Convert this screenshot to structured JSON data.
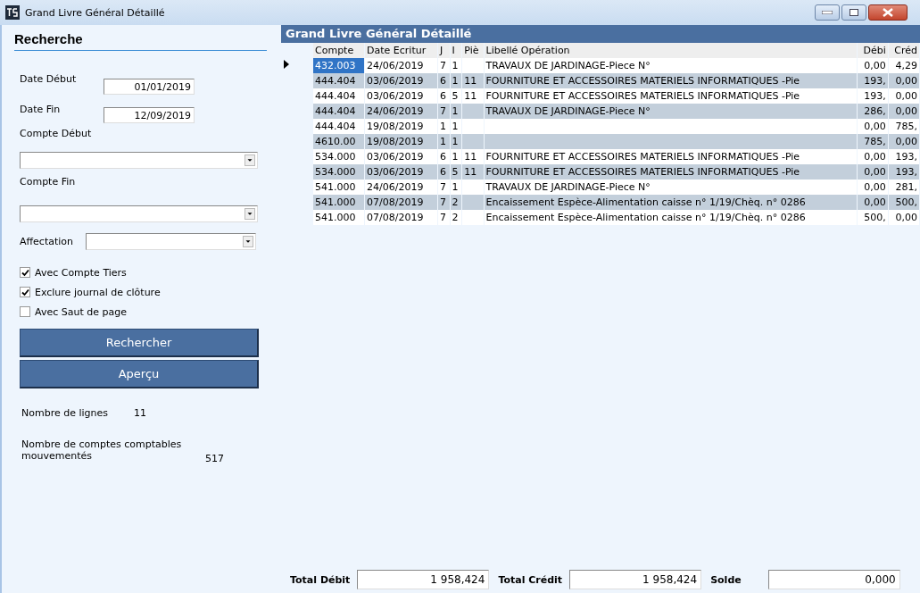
{
  "window": {
    "title": "Grand Livre Général Détaillé"
  },
  "search": {
    "title": "Recherche",
    "date_debut": {
      "label": "Date Début",
      "value": "01/01/2019"
    },
    "date_fin": {
      "label": "Date Fin",
      "value": "12/09/2019"
    },
    "compte_debut": {
      "label": "Compte Début"
    },
    "compte_fin": {
      "label": "Compte Fin"
    },
    "affectation": {
      "label": "Affectation"
    },
    "options": [
      {
        "label": "Avec Compte Tiers",
        "checked": true
      },
      {
        "label": "Exclure journal de clôture",
        "checked": true
      },
      {
        "label": "Avec Saut de page",
        "checked": false
      }
    ],
    "buttons": [
      "Rechercher",
      "Aperçu"
    ],
    "stats": [
      {
        "label": "Nombre de lignes",
        "value": "11"
      },
      {
        "label": "Nombre de comptes comptables mouvementés",
        "value": "517"
      }
    ]
  },
  "ledger": {
    "title": "Grand Livre Général Détaillé",
    "columns": [
      "Compte",
      "Date Ecritur",
      "J",
      "I",
      "Piè",
      "Libellé Opération",
      "Débi",
      "Créd"
    ],
    "rows": [
      {
        "selected": true,
        "cells": [
          "432.003",
          "24/06/2019",
          "7",
          "1",
          "",
          "TRAVAUX DE JARDINAGE-Piece N°",
          "0,00",
          "4,29"
        ]
      },
      {
        "selected": false,
        "cells": [
          "444.404",
          "03/06/2019",
          "6",
          "1",
          "11",
          "FOURNITURE ET ACCESSOIRES MATERIELS INFORMATIQUES -Pie",
          "193,",
          "0,00"
        ]
      },
      {
        "selected": false,
        "cells": [
          "444.404",
          "03/06/2019",
          "6",
          "5",
          "11",
          "FOURNITURE ET ACCESSOIRES MATERIELS INFORMATIQUES -Pie",
          "193,",
          "0,00"
        ]
      },
      {
        "selected": false,
        "cells": [
          "444.404",
          "24/06/2019",
          "7",
          "1",
          "",
          "TRAVAUX DE JARDINAGE-Piece N°",
          "286,",
          "0,00"
        ]
      },
      {
        "selected": false,
        "cells": [
          "444.404",
          "19/08/2019",
          "1",
          "1",
          "",
          "",
          "0,00",
          "785,"
        ]
      },
      {
        "selected": false,
        "cells": [
          "4610.00",
          "19/08/2019",
          "1",
          "1",
          "",
          "",
          "785,",
          "0,00"
        ]
      },
      {
        "selected": false,
        "cells": [
          "534.000",
          "03/06/2019",
          "6",
          "1",
          "11",
          "FOURNITURE ET ACCESSOIRES MATERIELS INFORMATIQUES -Pie",
          "0,00",
          "193,"
        ]
      },
      {
        "selected": false,
        "cells": [
          "534.000",
          "03/06/2019",
          "6",
          "5",
          "11",
          "FOURNITURE ET ACCESSOIRES MATERIELS INFORMATIQUES -Pie",
          "0,00",
          "193,"
        ]
      },
      {
        "selected": false,
        "cells": [
          "541.000",
          "24/06/2019",
          "7",
          "1",
          "",
          "TRAVAUX DE JARDINAGE-Piece N°",
          "0,00",
          "281,"
        ]
      },
      {
        "selected": false,
        "cells": [
          "541.000",
          "07/08/2019",
          "7",
          "2",
          "",
          "Encaissement Espèce-Alimentation caisse n° 1/19/Chèq. n° 0286",
          "0,00",
          "500,"
        ]
      },
      {
        "selected": false,
        "cells": [
          "541.000",
          "07/08/2019",
          "7",
          "2",
          "",
          "Encaissement Espèce-Alimentation caisse n° 1/19/Chèq. n° 0286",
          "500,",
          "0,00"
        ]
      }
    ]
  },
  "totals": [
    {
      "label": "Total Débit",
      "value": "1 958,424"
    },
    {
      "label": "Total Crédit",
      "value": "1 958,424"
    },
    {
      "label": "Solde",
      "value": "0,000"
    }
  ]
}
